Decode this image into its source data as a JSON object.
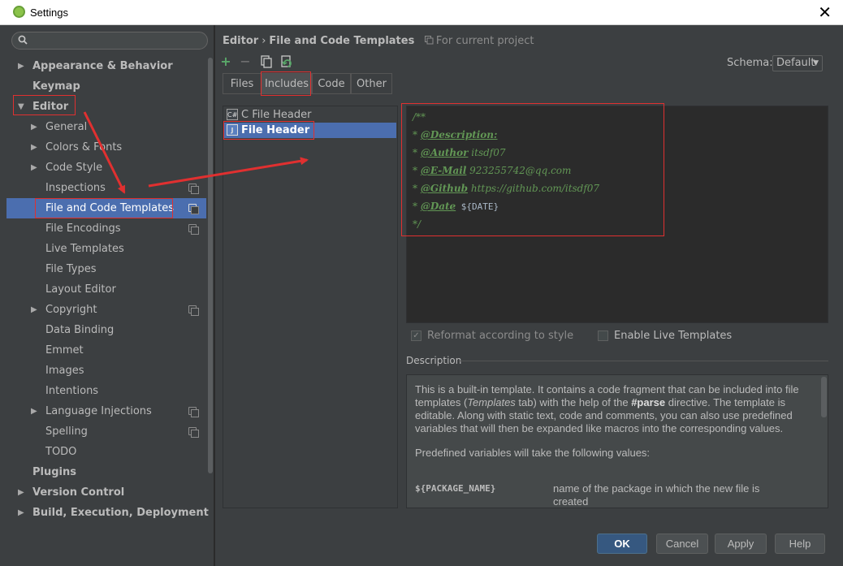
{
  "window": {
    "title": "Settings",
    "close_glyph": "✕"
  },
  "search": {
    "placeholder": ""
  },
  "sidebar": {
    "items": [
      {
        "label": "Appearance & Behavior",
        "arrow": "▶"
      },
      {
        "label": "Keymap"
      },
      {
        "label": "Editor",
        "arrow": "▼"
      },
      {
        "label": "General",
        "arrow": "▶"
      },
      {
        "label": "Colors & Fonts",
        "arrow": "▶"
      },
      {
        "label": "Code Style",
        "arrow": "▶"
      },
      {
        "label": "Inspections"
      },
      {
        "label": "File and Code Templates"
      },
      {
        "label": "File Encodings"
      },
      {
        "label": "Live Templates"
      },
      {
        "label": "File Types"
      },
      {
        "label": "Layout Editor"
      },
      {
        "label": "Copyright",
        "arrow": "▶"
      },
      {
        "label": "Data Binding"
      },
      {
        "label": "Emmet"
      },
      {
        "label": "Images"
      },
      {
        "label": "Intentions"
      },
      {
        "label": "Language Injections",
        "arrow": "▶"
      },
      {
        "label": "Spelling"
      },
      {
        "label": "TODO"
      },
      {
        "label": "Plugins"
      },
      {
        "label": "Version Control",
        "arrow": "▶"
      },
      {
        "label": "Build, Execution, Deployment",
        "arrow": "▶"
      }
    ]
  },
  "header": {
    "breadcrumb_parent": "Editor",
    "breadcrumb_sep": "›",
    "breadcrumb_current": "File and Code Templates",
    "scope": "For current project"
  },
  "toolbar": {
    "add": "+",
    "remove": "−"
  },
  "schema": {
    "label": "Schema:",
    "value": "Default"
  },
  "tabs": [
    "Files",
    "Includes",
    "Code",
    "Other"
  ],
  "templates": [
    {
      "label": "C File Header",
      "icon_text": "C#"
    },
    {
      "label": "File Header",
      "icon_text": "J"
    }
  ],
  "editor": {
    "lines": [
      {
        "text": "/**"
      },
      {
        "prefix": "* ",
        "tag": "@Description:",
        "value": ""
      },
      {
        "prefix": "* ",
        "tag": "@Author",
        "value": " itsdf07"
      },
      {
        "prefix": "* ",
        "tag": "@E-Mail",
        "value": " 923255742@qq.com"
      },
      {
        "prefix": "* ",
        "tag": "@Github",
        "value": " https://github.com/itsdf07"
      },
      {
        "prefix": "* ",
        "tag": "@Date",
        "var": " ${DATE}"
      },
      {
        "text": "*/"
      }
    ]
  },
  "options": {
    "reformat": "Reformat according to style",
    "reformat_checked": true,
    "live_templates": "Enable Live Templates",
    "live_templates_checked": false
  },
  "description": {
    "title": "Description",
    "p1_a": "This is a built-in template. It contains a code fragment that can be included into file templates (",
    "p1_em": "Templates",
    "p1_b": " tab) with the help of the ",
    "p1_strong": "#parse",
    "p1_c": " directive. The template is editable. Along with static text, code and comments, you can also use predefined variables that will then be expanded like macros into the corresponding values.",
    "p2": "Predefined variables will take the following values:",
    "var_name": "${PACKAGE_NAME}",
    "var_desc": "name of the package in which the new file is created"
  },
  "buttons": {
    "ok": "OK",
    "cancel": "Cancel",
    "apply": "Apply",
    "help": "Help"
  },
  "colors": {
    "selection": "#4b6eaf",
    "annotation": "#e03030",
    "comment": "#629755"
  }
}
